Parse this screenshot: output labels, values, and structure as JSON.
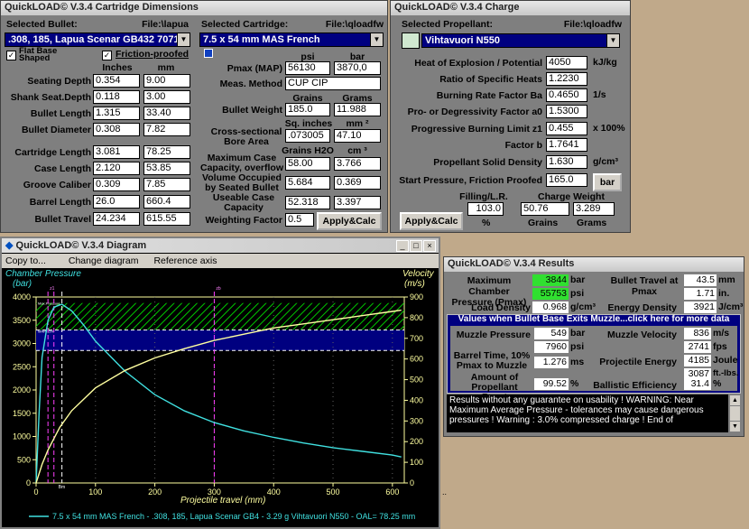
{
  "cartridge_window": {
    "title": "QuickLOAD© V.3.4 Cartridge Dimensions",
    "selected_bullet_label": "Selected Bullet:",
    "bullet_file": "File:\\lapua",
    "bullet_value": ".308, 185, Lapua Scenar GB432 7071",
    "selected_cartridge_label": "Selected Cartridge:",
    "cartridge_file": "File:\\qloadfw",
    "cartridge_value": "7.5 x 54 mm MAS French",
    "flat_base_label": "Flat Base Shaped",
    "friction_label": "Friction-proofed",
    "inches": "Inches",
    "mm": "mm",
    "rows": [
      {
        "label": "Seating Depth",
        "in": "0.354",
        "mm": "9.00"
      },
      {
        "label": "Shank Seat.Depth",
        "in": "0.118",
        "mm": "3.00"
      },
      {
        "label": "Bullet Length",
        "in": "1.315",
        "mm": "33.40"
      },
      {
        "label": "Bullet Diameter",
        "in": "0.308",
        "mm": "7.82"
      },
      {
        "label": "Cartridge Length",
        "in": "3.081",
        "mm": "78.25"
      },
      {
        "label": "Case Length",
        "in": "2.120",
        "mm": "53.85"
      },
      {
        "label": "Groove Caliber",
        "in": "0.309",
        "mm": "7.85"
      },
      {
        "label": "Barrel Length",
        "in": "26.0",
        "mm": "660.4"
      },
      {
        "label": "Bullet Travel",
        "in": "24.234",
        "mm": "615.55"
      }
    ],
    "psi": "psi",
    "bar": "bar",
    "pmax_label": "Pmax (MAP)",
    "pmax_psi": "56130",
    "pmax_bar": "3870,0",
    "meas_label": "Meas. Method",
    "meas_value": "CUP CIP",
    "grains": "Grains",
    "grams": "Grams",
    "bw_label": "Bullet Weight",
    "bw_gr": "185.0",
    "bw_g": "11.988",
    "sq_in": "Sq. inches",
    "mm2": "mm ²",
    "bore_label": "Cross-sectional Bore Area",
    "bore_in": ".073005",
    "bore_mm": "47.10",
    "grains_h2o": "Grains H2O",
    "cm3": "cm ³",
    "maxcap_label": "Maximum Case Capacity, overflow",
    "maxcap_gr": "58.00",
    "maxcap_cm": "3.766",
    "volocc_label": "Volume Occupied by Seated Bullet",
    "volocc_gr": "5.684",
    "volocc_cm": "0.369",
    "usable_label": "Useable Case Capacity",
    "usable_gr": "52.318",
    "usable_cm": "3.397",
    "wf_label": "Weighting Factor",
    "wf_value": "0.5",
    "apply_label": "Apply&Calc"
  },
  "charge_window": {
    "title": "QuickLOAD© V.3.4 Charge",
    "selected_label": "Selected Propellant:",
    "file": "File:\\qloadfw",
    "propellant": "Vihtavuori N550",
    "rows": [
      {
        "label": "Heat of Explosion / Potential",
        "value": "4050",
        "unit": "kJ/kg"
      },
      {
        "label": "Ratio of Specific Heats",
        "value": "1.2230",
        "unit": ""
      },
      {
        "label": "Burning Rate Factor  Ba",
        "value": "0.4650",
        "unit": "1/s"
      },
      {
        "label": "Pro- or Degressivity Factor  a0",
        "value": "1.5300",
        "unit": ""
      },
      {
        "label": "Progressive Burning Limit z1",
        "value": "0.455",
        "unit": "x 100%"
      },
      {
        "label": "Factor  b",
        "value": "1.7641",
        "unit": ""
      },
      {
        "label": "Propellant Solid Density",
        "value": "1.630",
        "unit": "g/cm³"
      },
      {
        "label": "Start Pressure, Friction Proofed",
        "value": "165.0",
        "unit": ""
      }
    ],
    "bar_button": "bar",
    "filling_label": "Filling/L.R.",
    "filling_value": "103.0",
    "filling_unit": "%",
    "charge_label": "Charge Weight",
    "charge_gr": "50.76",
    "charge_g": "3.289",
    "grains": "Grains",
    "grams": "Grams",
    "apply_label": "Apply&Calc"
  },
  "diagram_window": {
    "title": "QuickLOAD© V.3.4 Diagram",
    "menu": [
      "Copy to...",
      "Change diagram",
      "Reference axis"
    ],
    "left_axis_title": "Chamber Pressure",
    "left_axis_unit": "(bar)",
    "right_axis_title": "Velocity",
    "right_axis_unit": "(m/s)",
    "x_axis_title": "Projectile travel (mm)",
    "legend": "7.5 x 54 mm MAS French - .308, 185, Lapua Scenar GB4 - 3.29 g Vihtavuori N550 - OAL= 78.25 mm",
    "max_pressure_label": "Max.Pressure",
    "map_label": "MAP-15%",
    "left_ticks": [
      "4000",
      "3500",
      "3000",
      "2500",
      "2000",
      "1500",
      "1000",
      "500",
      "0"
    ],
    "right_ticks": [
      "900",
      "800",
      "700",
      "600",
      "500",
      "400",
      "300",
      "200",
      "100",
      "0"
    ],
    "x_ticks": [
      "0",
      "100",
      "200",
      "300",
      "400",
      "500",
      "600"
    ],
    "z1_label": "z1",
    "zb_label": "zb",
    "bm_label": "Bm",
    "colors": {
      "bg": "#000000",
      "pressure": "#40e0e0",
      "velocity": "#ffffa0",
      "hatch": "#00c800",
      "band": "#000080"
    }
  },
  "results_window": {
    "title": "QuickLOAD© V.3.4 Results",
    "mcp_label": "Maximum Chamber Pressure (Pmax)",
    "mcp_bar": "3844",
    "mcp_bar_unit": "bar",
    "mcp_psi": "55753",
    "mcp_psi_unit": "psi",
    "bt_label": "Bullet Travel at Pmax",
    "bt_mm": "43.5",
    "bt_mm_unit": "mm",
    "bt_in": "1.71",
    "bt_in_unit": "in.",
    "ld_label": "Load Density",
    "ld_value": "0.968",
    "ld_unit": "g/cm³",
    "ed_label": "Energy Density",
    "ed_value": "3921",
    "ed_unit": "J/cm³",
    "banner": "Values when Bullet Base Exits Muzzle...click here for more data",
    "mp_label": "Muzzle Pressure",
    "mp_bar": "549",
    "mp_bar_unit": "bar",
    "mp_psi": "7960",
    "mp_psi_unit": "psi",
    "mv_label": "Muzzle Velocity",
    "mv_ms": "836",
    "mv_ms_unit": "m/s",
    "mv_fps": "2741",
    "mv_fps_unit": "fps",
    "bt10_label": "Barrel Time, 10% Pmax to Muzzle",
    "bt10_value": "1.276",
    "bt10_unit": "ms",
    "pe_label": "Projectile Energy",
    "pe_j": "4185",
    "pe_j_unit": "Joule",
    "pe_ft": "3087",
    "pe_ft_unit": "ft.-lbs.",
    "apb_label": "Amount of Propellant Burnt",
    "apb_value": "99.52",
    "apb_unit": "%",
    "be_label": "Ballistic Efficiency",
    "be_value": "31.4",
    "be_unit": "%",
    "warning": "Results without any guarantee on usability !  WARNING: Near Maximum Average Pressure - tolerances may cause dangerous pressures !  Warning : 3.0% compressed charge !  End of"
  },
  "chart_data": {
    "type": "line",
    "xlabel": "Projectile travel (mm)",
    "xlim": [
      0,
      620
    ],
    "ylim_left": [
      0,
      4000
    ],
    "ylim_right": [
      0,
      900
    ],
    "series": [
      {
        "name": "Chamber Pressure",
        "axis": "left",
        "x": [
          0,
          5,
          10,
          20,
          30,
          43.5,
          60,
          80,
          100,
          150,
          200,
          250,
          300,
          350,
          400,
          450,
          500,
          550,
          600,
          615
        ],
        "values": [
          0,
          1500,
          2700,
          3500,
          3780,
          3844,
          3700,
          3400,
          3050,
          2400,
          1900,
          1550,
          1300,
          1120,
          980,
          860,
          760,
          680,
          600,
          560
        ]
      },
      {
        "name": "Velocity",
        "axis": "right",
        "x": [
          0,
          10,
          20,
          40,
          60,
          100,
          150,
          200,
          250,
          300,
          350,
          400,
          450,
          500,
          550,
          600,
          615
        ],
        "values": [
          0,
          90,
          160,
          270,
          350,
          460,
          545,
          605,
          650,
          690,
          720,
          750,
          770,
          790,
          810,
          830,
          836
        ]
      }
    ]
  }
}
